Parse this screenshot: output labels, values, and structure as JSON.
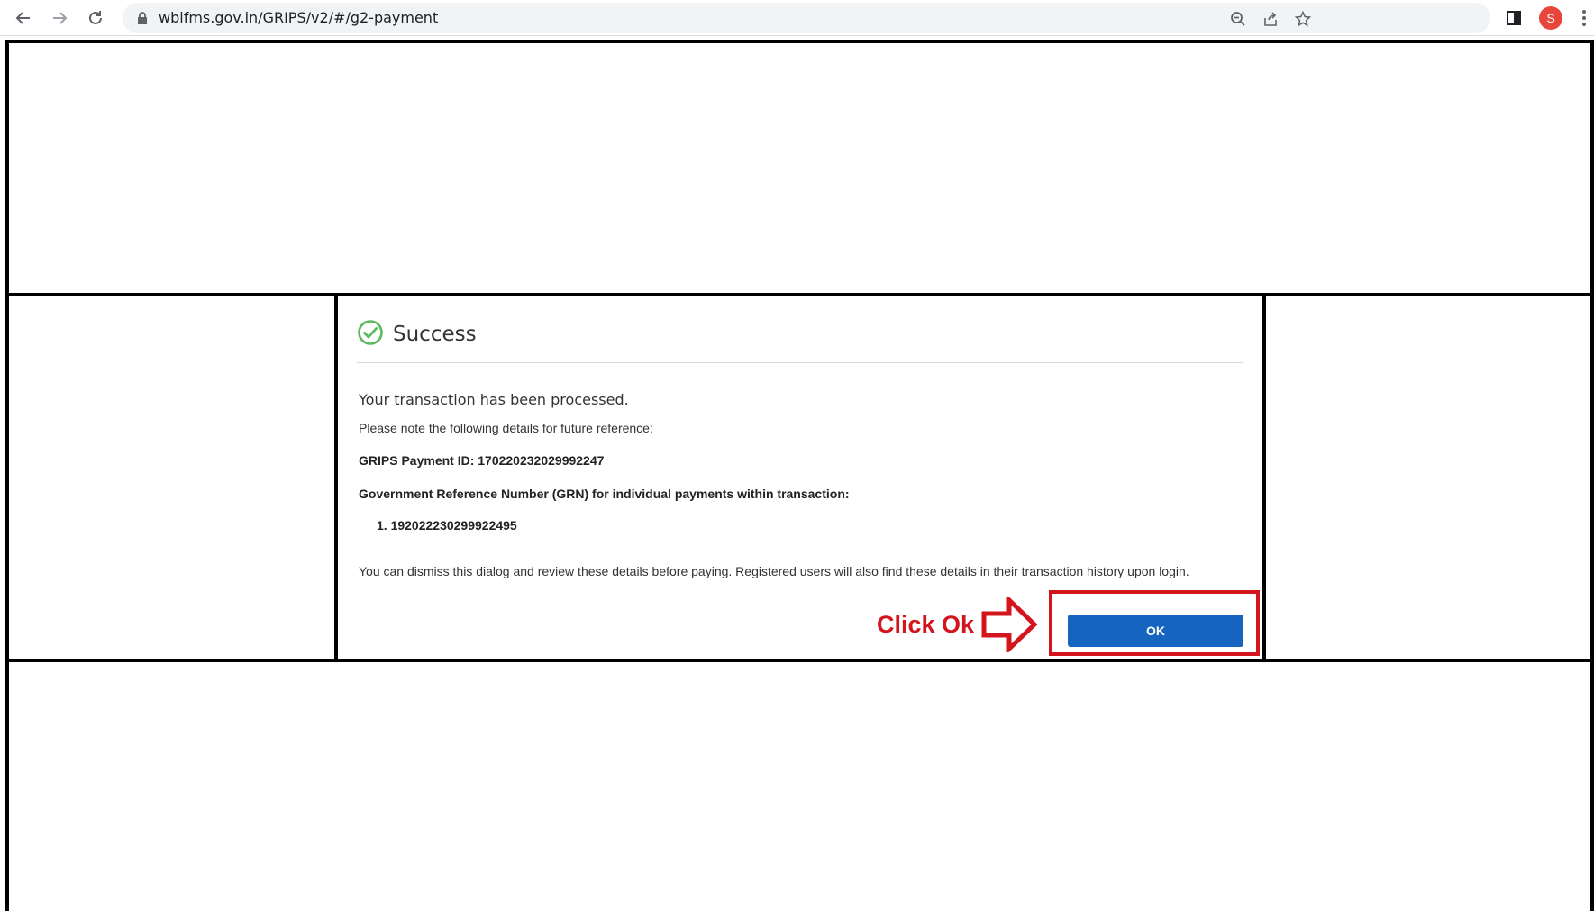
{
  "browser": {
    "url": "wbifms.gov.in/GRIPS/v2/#/g2-payment",
    "profile_initial": "S"
  },
  "dialog": {
    "title": "Success",
    "message": "Your transaction has been processed.",
    "note": "Please note the following details for future reference:",
    "payment_id_line": "GRIPS Payment ID: 170220232029992247",
    "grn_heading": "Government Reference Number (GRN) for individual payments within transaction:",
    "grn_items": [
      "1. 192022230299922495"
    ],
    "footer": "You can dismiss this dialog and review these details before paying. Registered users will also find these details in their transaction history upon login.",
    "ok_label": "OK"
  },
  "annotation": {
    "callout_label": "Click Ok"
  },
  "colors": {
    "success_green": "#5cb85c",
    "ok_button_blue": "#1565c0",
    "annotation_red": "#d3151e",
    "avatar": "#e8453c"
  },
  "icons": {
    "back": "back-arrow-icon",
    "forward": "forward-arrow-icon",
    "reload": "reload-icon",
    "lock": "lock-icon",
    "zoom": "zoom-icon",
    "share": "share-icon",
    "bookmark": "star-icon",
    "side_panel": "side-panel-icon",
    "menu": "kebab-menu-icon",
    "success": "check-circle-icon",
    "callout": "right-arrow-icon"
  }
}
